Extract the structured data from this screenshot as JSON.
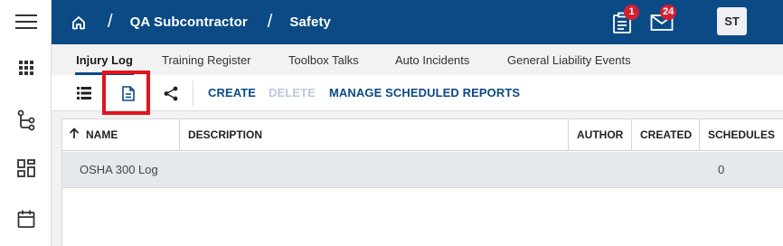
{
  "sidebar": {
    "icons": [
      "menu-icon",
      "apps-grid-icon",
      "workflow-icon",
      "dashboard-icon",
      "calendar-icon"
    ]
  },
  "header": {
    "breadcrumb": [
      "QA Subcontractor",
      "Safety"
    ],
    "separator": "/",
    "tasks_badge": "1",
    "messages_badge": "24",
    "avatar_initials": "ST",
    "colors": {
      "bar": "#0b4a85",
      "badge": "#d32030"
    }
  },
  "tabs": [
    "Injury Log",
    "Training Register",
    "Toolbox Talks",
    "Auto Incidents",
    "General Liability Events"
  ],
  "active_tab": "Injury Log",
  "toolbar": {
    "create_label": "CREATE",
    "delete_label": "DELETE",
    "manage_label": "MANAGE SCHEDULED REPORTS",
    "icons": [
      "list-view-icon",
      "document-icon",
      "share-icon"
    ],
    "highlight_color": "#e0141e"
  },
  "table": {
    "columns": [
      "NAME",
      "DESCRIPTION",
      "AUTHOR",
      "CREATED",
      "SCHEDULES"
    ],
    "sort_column": "NAME",
    "sort_direction": "ascending",
    "rows": [
      {
        "name": "OSHA 300 Log",
        "description": "",
        "author": "",
        "created": "",
        "schedules": "0"
      }
    ]
  }
}
